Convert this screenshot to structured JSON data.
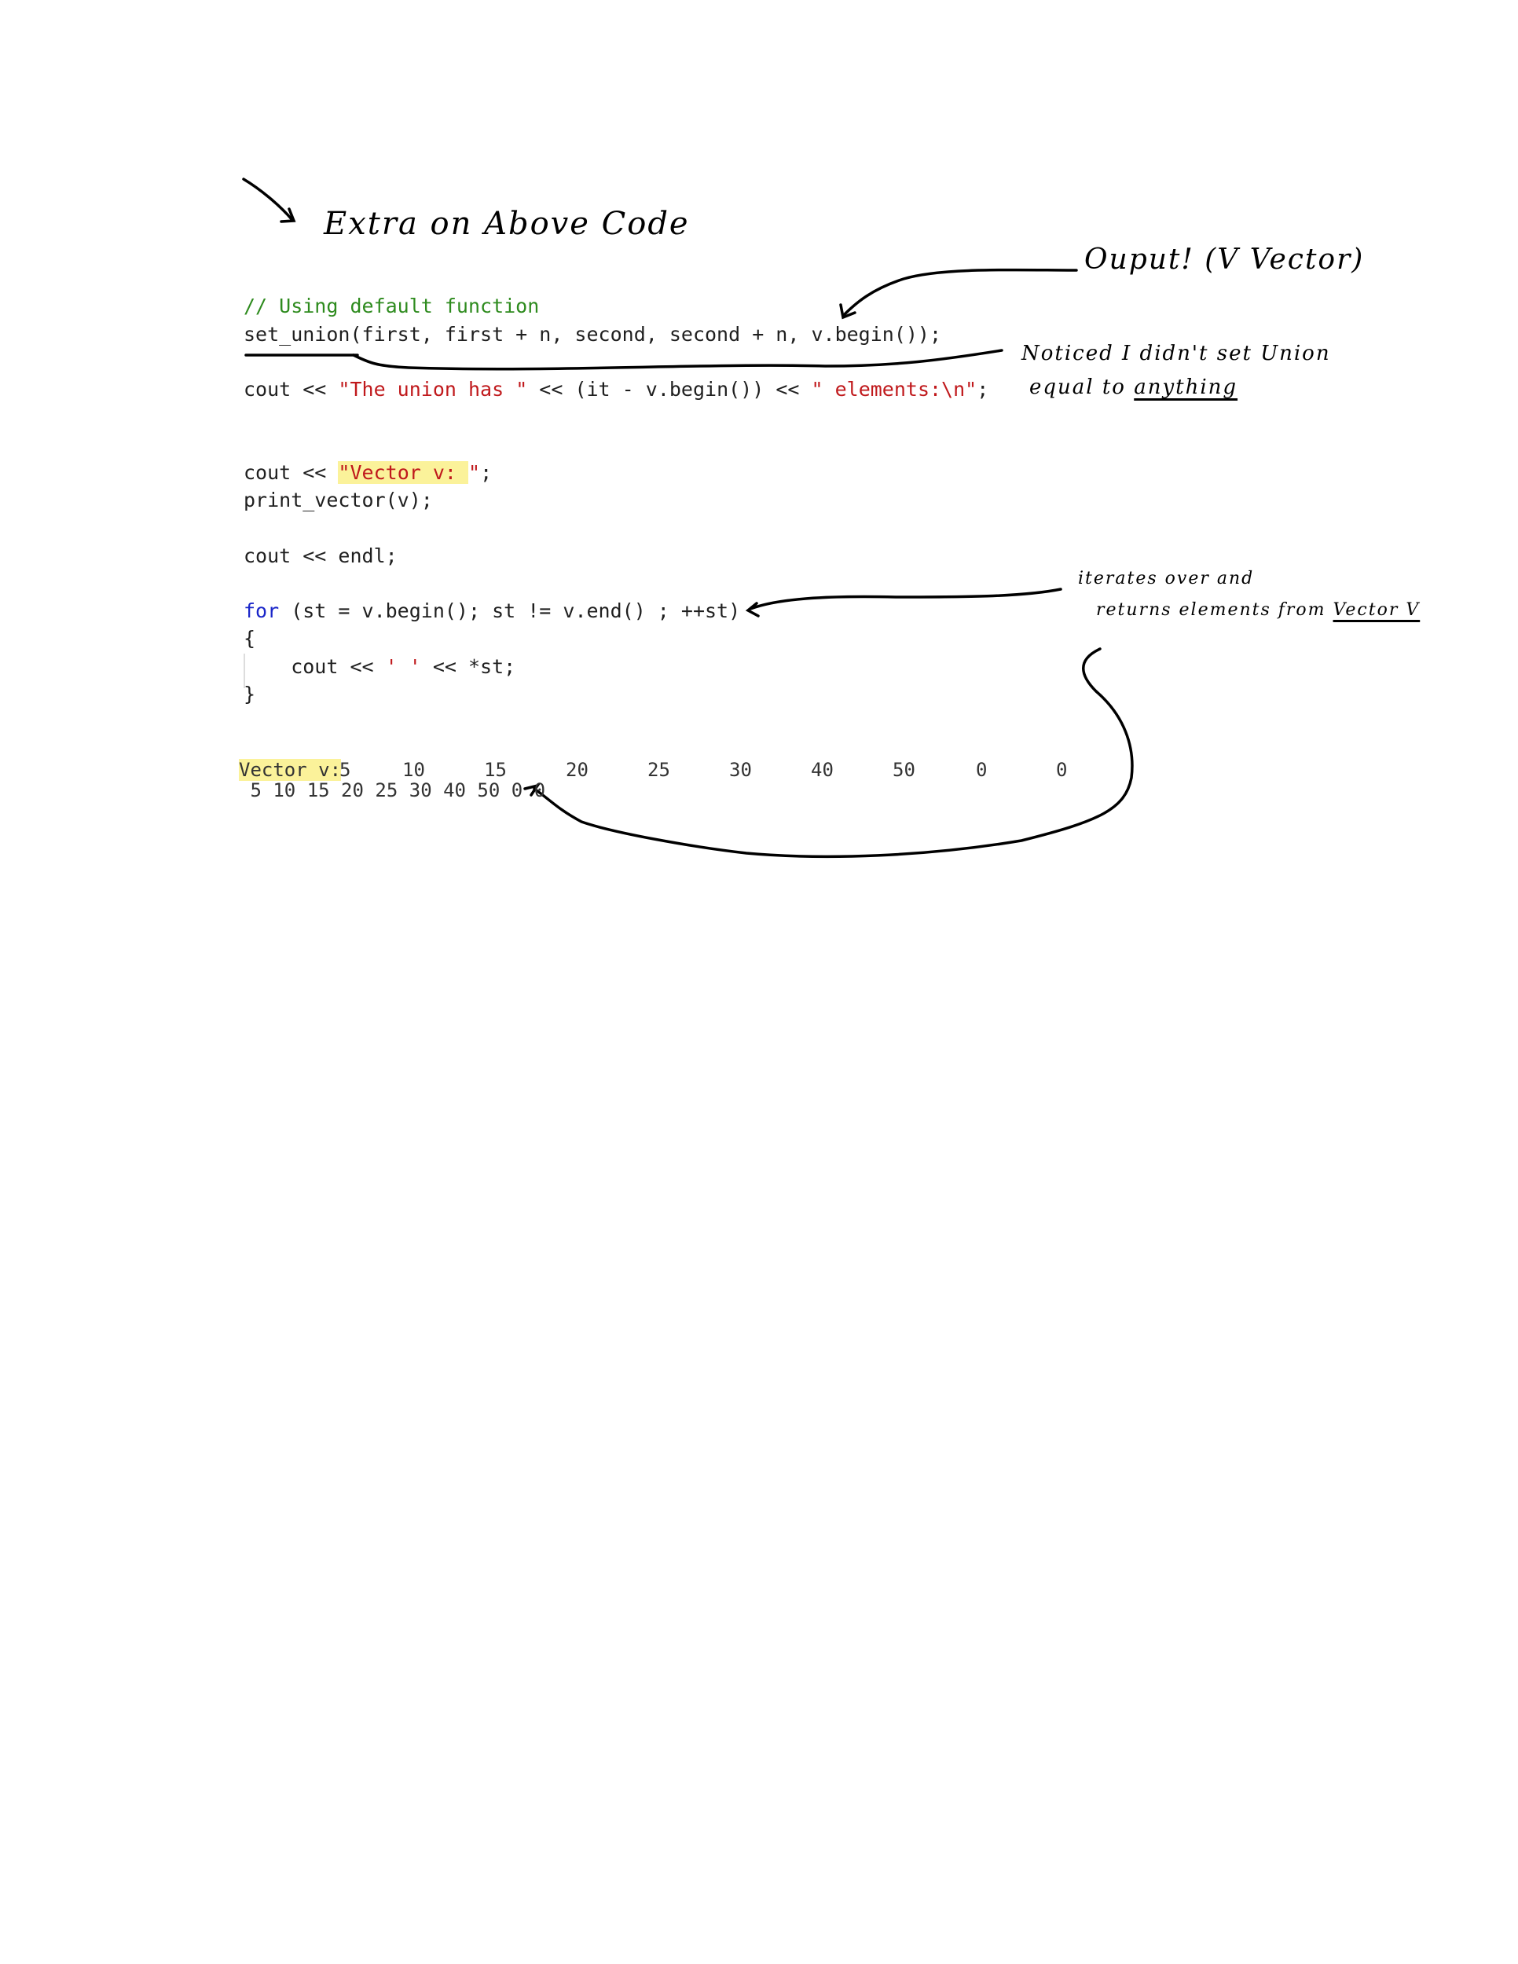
{
  "notes": {
    "title": "Extra on Above Code",
    "output_label": "Ouput! (V Vector)",
    "union_note_line1": "Noticed I didn't set Union",
    "union_note_line2_prefix": "equal to ",
    "union_note_line2_underlined": "anything",
    "iter_note_line1": "iterates over and",
    "iter_note_line2_prefix": "returns elements from ",
    "iter_note_line2_underlined": "Vector V"
  },
  "code": {
    "comment": "// Using default function",
    "set_union_line": "set_union(first, first + n, second, second + n, v.begin());",
    "cout_prefix": "cout << ",
    "union_str1": "\"The union has \"",
    "union_mid": " << (it - v.begin()) << ",
    "union_str2": "\" elements:\\n\"",
    "semicolon": ";",
    "vector_quote_open": "\"",
    "vector_label": "Vector v: ",
    "vector_quote_close": "\"",
    "print_line": "print_vector(v);",
    "endl_line": "cout << endl;",
    "for_kw": "for",
    "for_rest": " (st = v.begin(); st != v.end() ; ++st)",
    "brace_open": "{",
    "body_prefix": "    cout << ",
    "body_str": "' '",
    "body_rest": " << *st;",
    "brace_close": "}"
  },
  "output": {
    "vector_label": "Vector v:",
    "vector_values": [
      "5",
      "10",
      "15",
      "20",
      "25",
      "30",
      "40",
      "50",
      "0",
      "0"
    ],
    "loop_line": " 5 10 15 20 25 30 40 50 0 0"
  }
}
